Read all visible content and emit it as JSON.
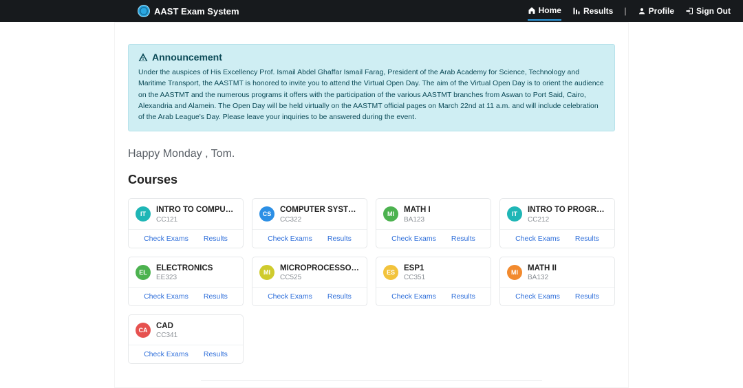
{
  "brand": {
    "title": "AAST Exam System"
  },
  "nav": {
    "home": "Home",
    "results": "Results",
    "profile": "Profile",
    "signout": "Sign Out"
  },
  "announcement": {
    "title": "Announcement",
    "body": "Under the auspices of His Excellency Prof. Ismail Abdel Ghaffar Ismail Farag, President of the Arab Academy for Science, Technology and Maritime Transport, the AASTMT is honored to invite you to attend the Virtual Open Day. The aim of the Virtual Open Day is to orient the audience on the AASTMT and the numerous programs it offers with the participation of the various AASTMT branches from Aswan to Port Said, Cairo, Alexandria and Alamein. The Open Day will be held virtually on the AASTMT official pages on March 22nd at 11 a.m. and will include celebration of the Arab League's Day. Please leave your inquiries to be answered during the event."
  },
  "greeting": "Happy Monday , Tom.",
  "sections": {
    "courses_title": "Courses"
  },
  "actions": {
    "check_exams": "Check Exams",
    "results": "Results"
  },
  "colors": {
    "teal": "#1FB6B6",
    "blue": "#2C8FE5",
    "green": "#4CB24F",
    "olive": "#CFCB2D",
    "gold": "#F2C33C",
    "orange": "#F28A2E",
    "red": "#E6514F"
  },
  "courses": [
    {
      "badge": "IT",
      "color": "teal",
      "title": "INTRO TO COMPUTER",
      "code": "CC121"
    },
    {
      "badge": "CS",
      "color": "blue",
      "title": "COMPUTER SYSTEM",
      "code": "CC322"
    },
    {
      "badge": "MI",
      "color": "green",
      "title": "MATH I",
      "code": "BA123"
    },
    {
      "badge": "IT",
      "color": "teal",
      "title": "INTRO TO PROGRAMMING",
      "code": "CC212"
    },
    {
      "badge": "EL",
      "color": "green",
      "title": "ELECTRONICS",
      "code": "EE323"
    },
    {
      "badge": "MI",
      "color": "olive",
      "title": "MICROPROCESSORS",
      "code": "CC525"
    },
    {
      "badge": "ES",
      "color": "gold",
      "title": "ESP1",
      "code": "CC351"
    },
    {
      "badge": "MI",
      "color": "orange",
      "title": "MATH II",
      "code": "BA132"
    },
    {
      "badge": "CA",
      "color": "red",
      "title": "CAD",
      "code": "CC341"
    }
  ]
}
